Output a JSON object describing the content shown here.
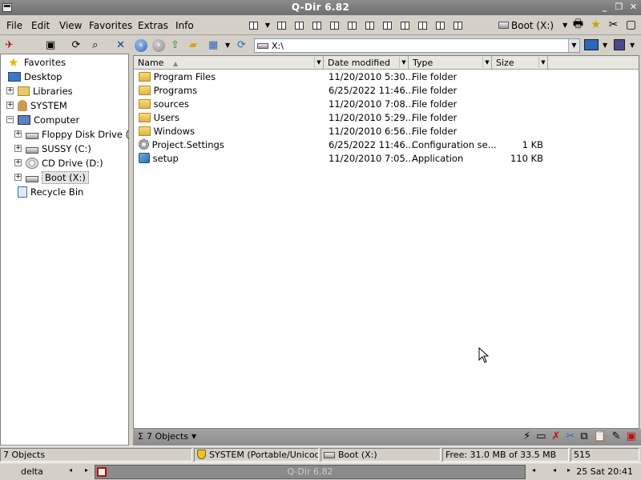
{
  "window": {
    "title": "Q-Dir 6.82"
  },
  "menu": [
    "File",
    "Edit",
    "View",
    "Favorites",
    "Extras",
    "Info"
  ],
  "toolbar": {
    "drive_selector": "Boot (X:)"
  },
  "tree": [
    {
      "label": "Favorites",
      "icon": "star-icon"
    },
    {
      "label": "Desktop",
      "icon": "desktop-icon"
    },
    {
      "label": "Libraries",
      "icon": "libraries-icon"
    },
    {
      "label": "SYSTEM",
      "icon": "user-folder-icon"
    },
    {
      "label": "Computer",
      "icon": "computer-icon"
    },
    {
      "label": "Floppy Disk Drive (A:)",
      "icon": "floppy-drive-icon"
    },
    {
      "label": "SUSSY (C:)",
      "icon": "hard-drive-icon"
    },
    {
      "label": "CD Drive (D:)",
      "icon": "cd-drive-icon"
    },
    {
      "label": "Boot (X:)",
      "icon": "hard-drive-icon"
    },
    {
      "label": "Recycle Bin",
      "icon": "recycle-bin-icon"
    }
  ],
  "address": {
    "path": "X:\\"
  },
  "columns": {
    "name": "Name",
    "modified": "Date modified",
    "type": "Type",
    "size": "Size"
  },
  "files": [
    {
      "name": "Program Files",
      "modified": "11/20/2010 5:30...",
      "type": "File folder",
      "size": "",
      "icon": "folder-icon"
    },
    {
      "name": "Programs",
      "modified": "6/25/2022 11:46...",
      "type": "File folder",
      "size": "",
      "icon": "folder-icon"
    },
    {
      "name": "sources",
      "modified": "11/20/2010 7:08...",
      "type": "File folder",
      "size": "",
      "icon": "folder-icon"
    },
    {
      "name": "Users",
      "modified": "11/20/2010 5:29...",
      "type": "File folder",
      "size": "",
      "icon": "folder-icon"
    },
    {
      "name": "Windows",
      "modified": "11/20/2010 6:56...",
      "type": "File folder",
      "size": "",
      "icon": "folder-icon"
    },
    {
      "name": "Project.Settings",
      "modified": "6/25/2022 11:46...",
      "type": "Configuration se...",
      "size": "1 KB",
      "icon": "settings-file-icon"
    },
    {
      "name": "setup",
      "modified": "11/20/2010 7:05...",
      "type": "Application",
      "size": "110 KB",
      "icon": "application-icon"
    }
  ],
  "objects_label": "7 Objects",
  "status": {
    "objects": "7 Objects",
    "user": "SYSTEM (Portable/Unicode)",
    "drive": "Boot (X:)",
    "free": "Free: 31.0 MB of 33.5 MB",
    "num": "515"
  },
  "taskbar": {
    "label": "delta",
    "app": "Q-Dir 6.82",
    "clock": "25 Sat 20:41"
  }
}
